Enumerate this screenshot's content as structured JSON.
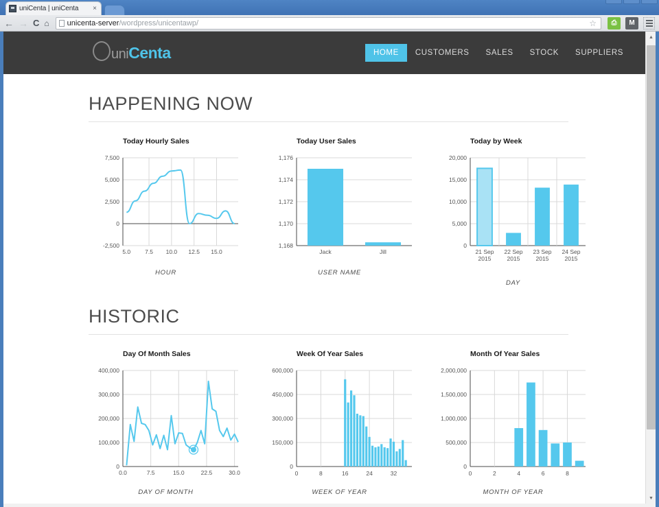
{
  "browser": {
    "tab_title": "uniCenta | uniCenta",
    "tab_close": "×",
    "back_icon": "←",
    "forward_icon": "→",
    "reload_icon": "C",
    "home_icon": "⌂",
    "url_main": "unicenta-server",
    "url_path": "/wordpress/unicentawp/",
    "star_icon": "☆",
    "ext_print_label": "⎙",
    "ext_m_label": "M"
  },
  "site": {
    "logo_uni": "uni",
    "logo_centa": "Centa",
    "nav": [
      {
        "label": "HOME",
        "active": true
      },
      {
        "label": "CUSTOMERS",
        "active": false
      },
      {
        "label": "SALES",
        "active": false
      },
      {
        "label": "STOCK",
        "active": false
      },
      {
        "label": "SUPPLIERS",
        "active": false
      }
    ]
  },
  "sections": {
    "happening_now": "HAPPENING NOW",
    "historic": "HISTORIC"
  },
  "colors": {
    "accent": "#4fc3e8",
    "chart_fill": "#55c8ed",
    "header_bg": "#3b3b3b",
    "heading_text": "#4c4c4c"
  },
  "chart_data": [
    {
      "id": "today-hourly-sales",
      "type": "line",
      "title": "Today Hourly Sales",
      "xlabel": "HOUR",
      "ylabel": "",
      "xticks": [
        "5.0",
        "7.5",
        "10.0",
        "12.5",
        "15.0"
      ],
      "yticks": [
        "-2,500",
        "0",
        "2,500",
        "5,000",
        "7,500"
      ],
      "xlim": [
        4.6,
        17.4
      ],
      "ylim": [
        -2500,
        7500
      ],
      "grid": true,
      "x": [
        5,
        6,
        7,
        8,
        9,
        10,
        11,
        12,
        13,
        14,
        15,
        16,
        17
      ],
      "values": [
        1300,
        2600,
        3700,
        4600,
        5400,
        6000,
        6100,
        0,
        1150,
        950,
        600,
        1450,
        0
      ]
    },
    {
      "id": "today-user-sales",
      "type": "bar",
      "title": "Today User Sales",
      "xlabel": "USER NAME",
      "ylabel": "",
      "categories": [
        "Jack",
        "Jill"
      ],
      "values": [
        1175,
        1168.3
      ],
      "yticks": [
        "1,168",
        "1,170",
        "1,172",
        "1,174",
        "1,176"
      ],
      "ylim": [
        1168,
        1176
      ],
      "grid": true
    },
    {
      "id": "today-by-week",
      "type": "bar",
      "title": "Today by Week",
      "xlabel": "DAY",
      "ylabel": "",
      "categories": [
        "21 Sep 2015",
        "22 Sep 2015",
        "23 Sep 2015",
        "24 Sep 2015"
      ],
      "values": [
        17600,
        2900,
        13200,
        13900
      ],
      "yticks": [
        "0",
        "5,000",
        "10,000",
        "15,000",
        "20,000"
      ],
      "ylim": [
        0,
        20000
      ],
      "selected_index": 0,
      "grid": true
    },
    {
      "id": "day-of-month-sales",
      "type": "line",
      "title": "Day Of Month Sales",
      "xlabel": "DAY OF MONTH",
      "ylabel": "",
      "xticks": [
        "0.0",
        "7.5",
        "15.0",
        "22.5",
        "30.0"
      ],
      "yticks": [
        "0",
        "100,000",
        "200,000",
        "300,000",
        "400,000"
      ],
      "xlim": [
        0,
        31
      ],
      "ylim": [
        0,
        400000
      ],
      "grid": true,
      "selected_point": {
        "x": 19,
        "y": 70000
      },
      "x": [
        1,
        2,
        3,
        4,
        5,
        6,
        7,
        8,
        9,
        10,
        11,
        12,
        13,
        14,
        15,
        16,
        17,
        18,
        19,
        20,
        21,
        22,
        23,
        24,
        25,
        26,
        27,
        28,
        29,
        30,
        31
      ],
      "values": [
        5000,
        175000,
        105000,
        248000,
        180000,
        175000,
        150000,
        90000,
        132000,
        75000,
        130000,
        70000,
        212000,
        95000,
        140000,
        138000,
        90000,
        78000,
        70000,
        100000,
        150000,
        95000,
        355000,
        240000,
        230000,
        150000,
        125000,
        160000,
        110000,
        135000,
        102000
      ]
    },
    {
      "id": "week-of-year-sales",
      "type": "bar",
      "title": "Week Of Year Sales",
      "xlabel": "WEEK OF YEAR",
      "ylabel": "",
      "xticks": [
        "0",
        "8",
        "16",
        "24",
        "32"
      ],
      "yticks": [
        "0",
        "150,000",
        "300,000",
        "450,000",
        "600,000"
      ],
      "ylim": [
        0,
        600000
      ],
      "grid": true,
      "categories": [
        16,
        17,
        18,
        19,
        20,
        21,
        22,
        23,
        24,
        25,
        26,
        27,
        28,
        29,
        30,
        31,
        32,
        33,
        34,
        35,
        36
      ],
      "values": [
        545000,
        400000,
        475000,
        445000,
        330000,
        320000,
        315000,
        250000,
        185000,
        130000,
        120000,
        125000,
        140000,
        120000,
        115000,
        175000,
        155000,
        95000,
        110000,
        165000,
        40000
      ]
    },
    {
      "id": "month-of-year-sales",
      "type": "bar",
      "title": "Month Of Year Sales",
      "xlabel": "MONTH OF YEAR",
      "ylabel": "",
      "xticks": [
        "0",
        "2",
        "4",
        "6",
        "8"
      ],
      "yticks": [
        "0",
        "500,000",
        "1,000,000",
        "1,500,000",
        "2,000,000"
      ],
      "ylim": [
        0,
        2000000
      ],
      "grid": true,
      "categories": [
        4,
        5,
        6,
        7,
        8,
        9
      ],
      "values": [
        800000,
        1750000,
        760000,
        480000,
        500000,
        120000
      ]
    }
  ]
}
